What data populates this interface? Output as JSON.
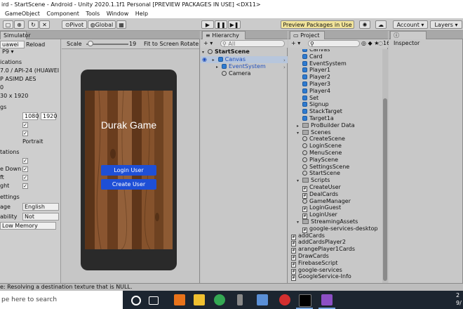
{
  "window": {
    "title": "ird - StartScene - Android - Unity 2020.1.1f1 Personal [PREVIEW PACKAGES IN USE] <DX11>"
  },
  "menu": [
    "GameObject",
    "Component",
    "Tools",
    "Window",
    "Help"
  ],
  "toolbar": {
    "pivot_label": "Pivot",
    "global_label": "Global",
    "preview_packages_label": "Preview Packages in Use",
    "account_label": "Account",
    "layers_label": "Layers"
  },
  "simulator": {
    "tab_label": "Simulator",
    "device": "uawei P9",
    "reload_label": "Reload",
    "scale_label": "Scale",
    "scale_value": "19",
    "fit_label": "Fit to Screen",
    "rotate_label": "Rotate",
    "info_lines": [
      "ications",
      "7.0 / API-24 (HUAWEI",
      "P ASIMD AES",
      "0",
      "30 x 1920"
    ],
    "ngs_label": "gs",
    "res_w": "1080",
    "res_h": "1920",
    "portrait_label": "Portrait",
    "rotations_label": "tations",
    "rotation_items": [
      "e Down",
      "ft",
      "ght"
    ],
    "settings_label": "ettings",
    "language_label": "age",
    "language_value": "English",
    "reach_label": "ability",
    "reach_value": "Not Reachabl",
    "memory_label": "Low Memory"
  },
  "game": {
    "title": "Durak Game",
    "login_label": "Login User",
    "create_label": "Create User",
    "wood_color": "#7a4a24",
    "button_color": "#1e4fd6"
  },
  "hierarchy": {
    "tab_label": "Hierarchy",
    "search_placeholder": "All",
    "scene": "StartScene",
    "items": [
      "Canvas",
      "EventSystem",
      "Camera"
    ]
  },
  "project": {
    "tab_label": "Project",
    "badge": "16",
    "items": [
      {
        "label": "Canvas",
        "icon": "cube",
        "indent": 2
      },
      {
        "label": "Card",
        "icon": "cube",
        "indent": 2
      },
      {
        "label": "EventSystem",
        "icon": "cube",
        "indent": 2
      },
      {
        "label": "Player1",
        "icon": "cube",
        "indent": 2
      },
      {
        "label": "Player2",
        "icon": "cube",
        "indent": 2
      },
      {
        "label": "Player3",
        "icon": "cube",
        "indent": 2
      },
      {
        "label": "Player4",
        "icon": "cube",
        "indent": 2
      },
      {
        "label": "Set",
        "icon": "cube",
        "indent": 2
      },
      {
        "label": "Signup",
        "icon": "cube",
        "indent": 2
      },
      {
        "label": "StackTarget",
        "icon": "cube",
        "indent": 2
      },
      {
        "label": "Target1a",
        "icon": "cube",
        "indent": 2
      },
      {
        "label": "ProBuilder Data",
        "icon": "folder",
        "indent": 1,
        "arrow": "▸"
      },
      {
        "label": "Scenes",
        "icon": "folder",
        "indent": 1,
        "arrow": "▾"
      },
      {
        "label": "CreateScene",
        "icon": "scene",
        "indent": 2
      },
      {
        "label": "LoginScene",
        "icon": "scene",
        "indent": 2
      },
      {
        "label": "MenuScene",
        "icon": "scene",
        "indent": 2
      },
      {
        "label": "PlayScene",
        "icon": "scene",
        "indent": 2
      },
      {
        "label": "SettingsScene",
        "icon": "scene",
        "indent": 2
      },
      {
        "label": "StartScene",
        "icon": "scene",
        "indent": 2
      },
      {
        "label": "Scripts",
        "icon": "folder",
        "indent": 1,
        "arrow": "▾"
      },
      {
        "label": "CreateUser",
        "icon": "script",
        "indent": 2
      },
      {
        "label": "DealCards",
        "icon": "script",
        "indent": 2
      },
      {
        "label": "GameManager",
        "icon": "scene",
        "indent": 2
      },
      {
        "label": "LoginGuest",
        "icon": "script",
        "indent": 2
      },
      {
        "label": "LoginUser",
        "icon": "script",
        "indent": 2
      },
      {
        "label": "StreamingAssets",
        "icon": "folder",
        "indent": 1,
        "arrow": "▾"
      },
      {
        "label": "google-services-desktop",
        "icon": "script",
        "indent": 2
      },
      {
        "label": "addCards",
        "icon": "script",
        "indent": 0
      },
      {
        "label": "addCardsPlayer2",
        "icon": "script",
        "indent": 0
      },
      {
        "label": "arangePlayer1Cards",
        "icon": "script",
        "indent": 0
      },
      {
        "label": "DrawCards",
        "icon": "script",
        "indent": 0
      },
      {
        "label": "FirebaseScript",
        "icon": "script",
        "indent": 0
      },
      {
        "label": "google-services",
        "icon": "script",
        "indent": 0
      },
      {
        "label": "GoogleService-Info",
        "icon": "script",
        "indent": 0
      }
    ]
  },
  "inspector": {
    "tab_label": "Inspector"
  },
  "status": {
    "message": "e: Resolving a destination texture that is NULL."
  },
  "taskbar": {
    "search_placeholder": "pe here to search",
    "clock_line1": "2",
    "clock_line2": "9/"
  }
}
